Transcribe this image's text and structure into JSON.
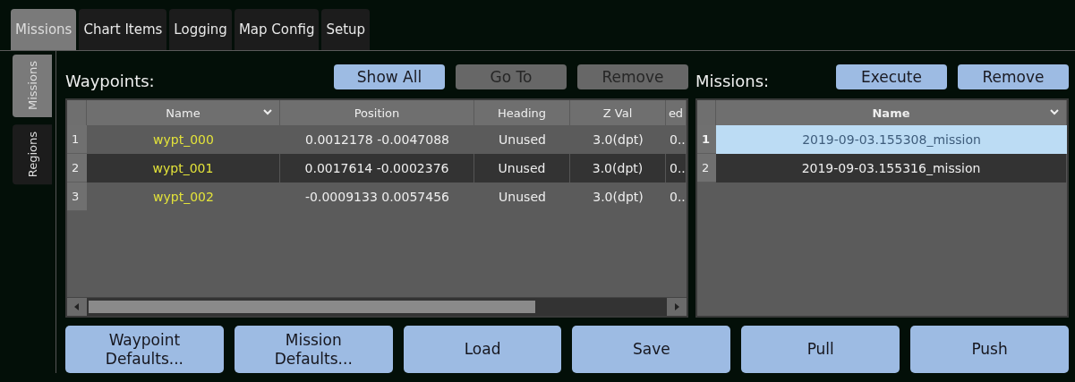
{
  "tabs": [
    {
      "label": "Missions",
      "selected": true
    },
    {
      "label": "Chart Items",
      "selected": false
    },
    {
      "label": "Logging",
      "selected": false
    },
    {
      "label": "Map Config",
      "selected": false
    },
    {
      "label": "Setup",
      "selected": false
    }
  ],
  "side_tabs": [
    {
      "label": "Missions",
      "selected": true
    },
    {
      "label": "Regions",
      "selected": false
    }
  ],
  "waypoints": {
    "title": "Waypoints:",
    "buttons": [
      {
        "label": "Show All",
        "disabled": false
      },
      {
        "label": "Go To",
        "disabled": true
      },
      {
        "label": "Remove",
        "disabled": true
      }
    ],
    "table": {
      "columns": [
        {
          "label": "Name",
          "sorted": true
        },
        {
          "label": "Position",
          "sorted": false
        },
        {
          "label": "Heading",
          "sorted": false
        },
        {
          "label": "Z Val",
          "sorted": false
        },
        {
          "label": "ed",
          "sorted": false
        }
      ],
      "rows": [
        {
          "number": "1",
          "cells": [
            "wypt_000",
            "0.0012178 -0.0047088",
            "Unused",
            "3.0(dpt)",
            "0.."
          ]
        },
        {
          "number": "2",
          "cells": [
            "wypt_001",
            "0.0017614 -0.0002376",
            "Unused",
            "3.0(dpt)",
            "0.."
          ]
        },
        {
          "number": "3",
          "cells": [
            "wypt_002",
            "-0.0009133 0.0057456",
            "Unused",
            "3.0(dpt)",
            "0.."
          ]
        }
      ]
    }
  },
  "missions": {
    "title": "Missions:",
    "buttons": [
      {
        "label": "Execute",
        "disabled": false
      },
      {
        "label": "Remove",
        "disabled": false
      }
    ],
    "table": {
      "columns": [
        {
          "label": "Name",
          "sorted": true
        }
      ],
      "rows": [
        {
          "number": "1",
          "selected": true,
          "cells": [
            "2019-09-03.155308_mission"
          ]
        },
        {
          "number": "2",
          "selected": false,
          "cells": [
            "2019-09-03.155316_mission"
          ]
        }
      ]
    }
  },
  "actions": [
    {
      "label": "Waypoint\nDefaults..."
    },
    {
      "label": "Mission\nDefaults..."
    },
    {
      "label": "Load"
    },
    {
      "label": "Save"
    },
    {
      "label": "Pull"
    },
    {
      "label": "Push"
    }
  ]
}
